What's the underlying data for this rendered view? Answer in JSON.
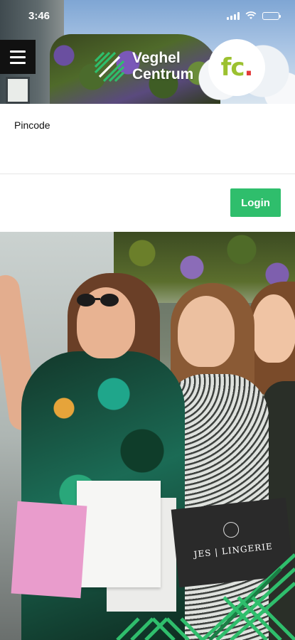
{
  "status_bar": {
    "time": "3:46"
  },
  "header": {
    "logo_line1": "Veghel",
    "logo_line2": "Centrum",
    "badge_text": "fc",
    "badge_dot": "."
  },
  "form": {
    "pincode_label": "Pincode",
    "pincode_value": "",
    "login_label": "Login"
  },
  "photo": {
    "bag_brand": "JES | LINGERIE"
  },
  "colors": {
    "accent_green": "#2fbe6c",
    "logo_green": "#2fbe6c",
    "badge_green": "#9cc130",
    "badge_dot_red": "#e23a3a"
  },
  "icons": [
    "menu-icon",
    "wifi-icon",
    "signal-icon",
    "battery-icon",
    "logo-mark-icon"
  ]
}
